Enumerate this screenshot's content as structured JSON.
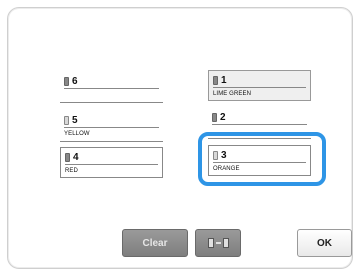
{
  "slots": [
    {
      "number": "6",
      "name": ""
    },
    {
      "number": "5",
      "name": "YELLOW"
    },
    {
      "number": "4",
      "name": "RED"
    },
    {
      "number": "1",
      "name": "LIME GREEN"
    },
    {
      "number": "2",
      "name": ""
    },
    {
      "number": "3",
      "name": "ORANGE"
    }
  ],
  "buttons": {
    "clear": "Clear",
    "ok": "OK"
  },
  "colors": {
    "highlight": "#2e95e6",
    "button_gray": "#8a8a8a"
  }
}
